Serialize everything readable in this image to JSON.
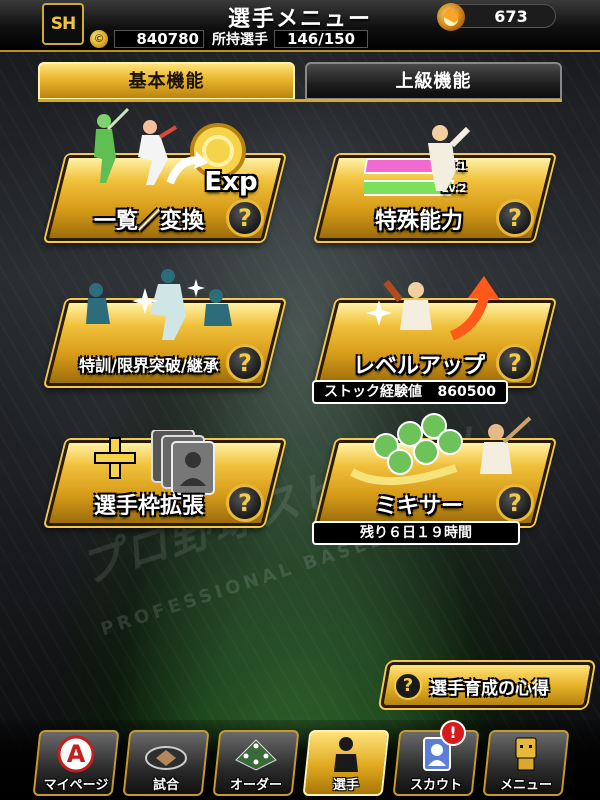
{
  "header": {
    "title": "選手メニュー",
    "team_logo_text": "SH",
    "coin_symbol": "©",
    "coins": "840780",
    "owned_label": "所持選手",
    "owned_count": "146/150",
    "premium_currency": "673"
  },
  "tabs": [
    {
      "label": "基本機能",
      "active": true
    },
    {
      "label": "上級機能",
      "active": false
    }
  ],
  "cards": {
    "list_convert": {
      "label": "一覧／変換",
      "art_text": "Exp"
    },
    "special_ability": {
      "label": "特殊能力",
      "art_lv1": "Lv.1",
      "art_lv2": "Lv.2"
    },
    "training": {
      "label": "特訓/限界突破/継承"
    },
    "level_up": {
      "label": "レベルアップ",
      "info_label": "ストック経験値",
      "info_value": "860500"
    },
    "expand_slots": {
      "label": "選手枠拡張"
    },
    "mixer": {
      "label": "ミキサー",
      "info_text": "残り６日１９時間"
    }
  },
  "help_symbol": "?",
  "watermark": {
    "line1": "プロ野球スピリッツ",
    "line2": "PROFESSIONAL BASEBALL SPIRITS"
  },
  "guide_button": {
    "label": "選手育成の心得",
    "icon": "?"
  },
  "bottom_nav": [
    {
      "label": "マイページ",
      "icon": "a-logo-icon"
    },
    {
      "label": "試合",
      "icon": "stadium-icon"
    },
    {
      "label": "オーダー",
      "icon": "field-lineup-icon"
    },
    {
      "label": "選手",
      "icon": "player-icon",
      "active": true
    },
    {
      "label": "スカウト",
      "icon": "scout-card-icon",
      "badge": "!"
    },
    {
      "label": "メニュー",
      "icon": "robot-icon"
    }
  ],
  "colors": {
    "accent_gold": "#e9b42d",
    "badge_red": "#d91a1a"
  }
}
